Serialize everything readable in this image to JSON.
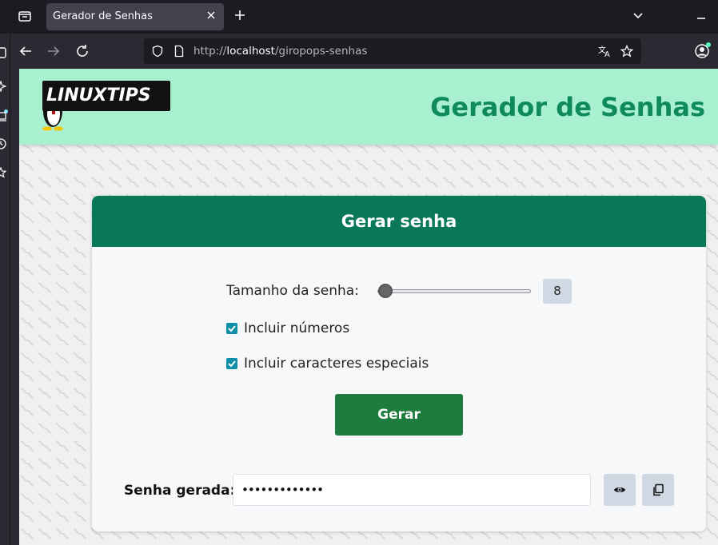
{
  "browser": {
    "tab_title": "Gerador de Senhas",
    "url_prefix": "http://",
    "url_host": "localhost",
    "url_path": "/giropops-senhas"
  },
  "header": {
    "logo_text": "LINUXTIPS",
    "title": "Gerador de Senhas"
  },
  "card": {
    "title": "Gerar senha",
    "length_label": "Tamanho da senha:",
    "length_value": "8",
    "length_slider_fraction": 0.0,
    "include_numbers": {
      "label": "Incluir números",
      "checked": true
    },
    "include_special": {
      "label": "Incluir caracteres especiais",
      "checked": true
    },
    "generate_label": "Gerar",
    "output_label": "Senha gerada:",
    "output_value": "•••••••••••••"
  },
  "colors": {
    "header_bg": "#a8f0d0",
    "title_green": "#0e8a5e",
    "card_header": "#087858",
    "button_green": "#1e7d3e",
    "checkbox": "#0e8fa8"
  }
}
